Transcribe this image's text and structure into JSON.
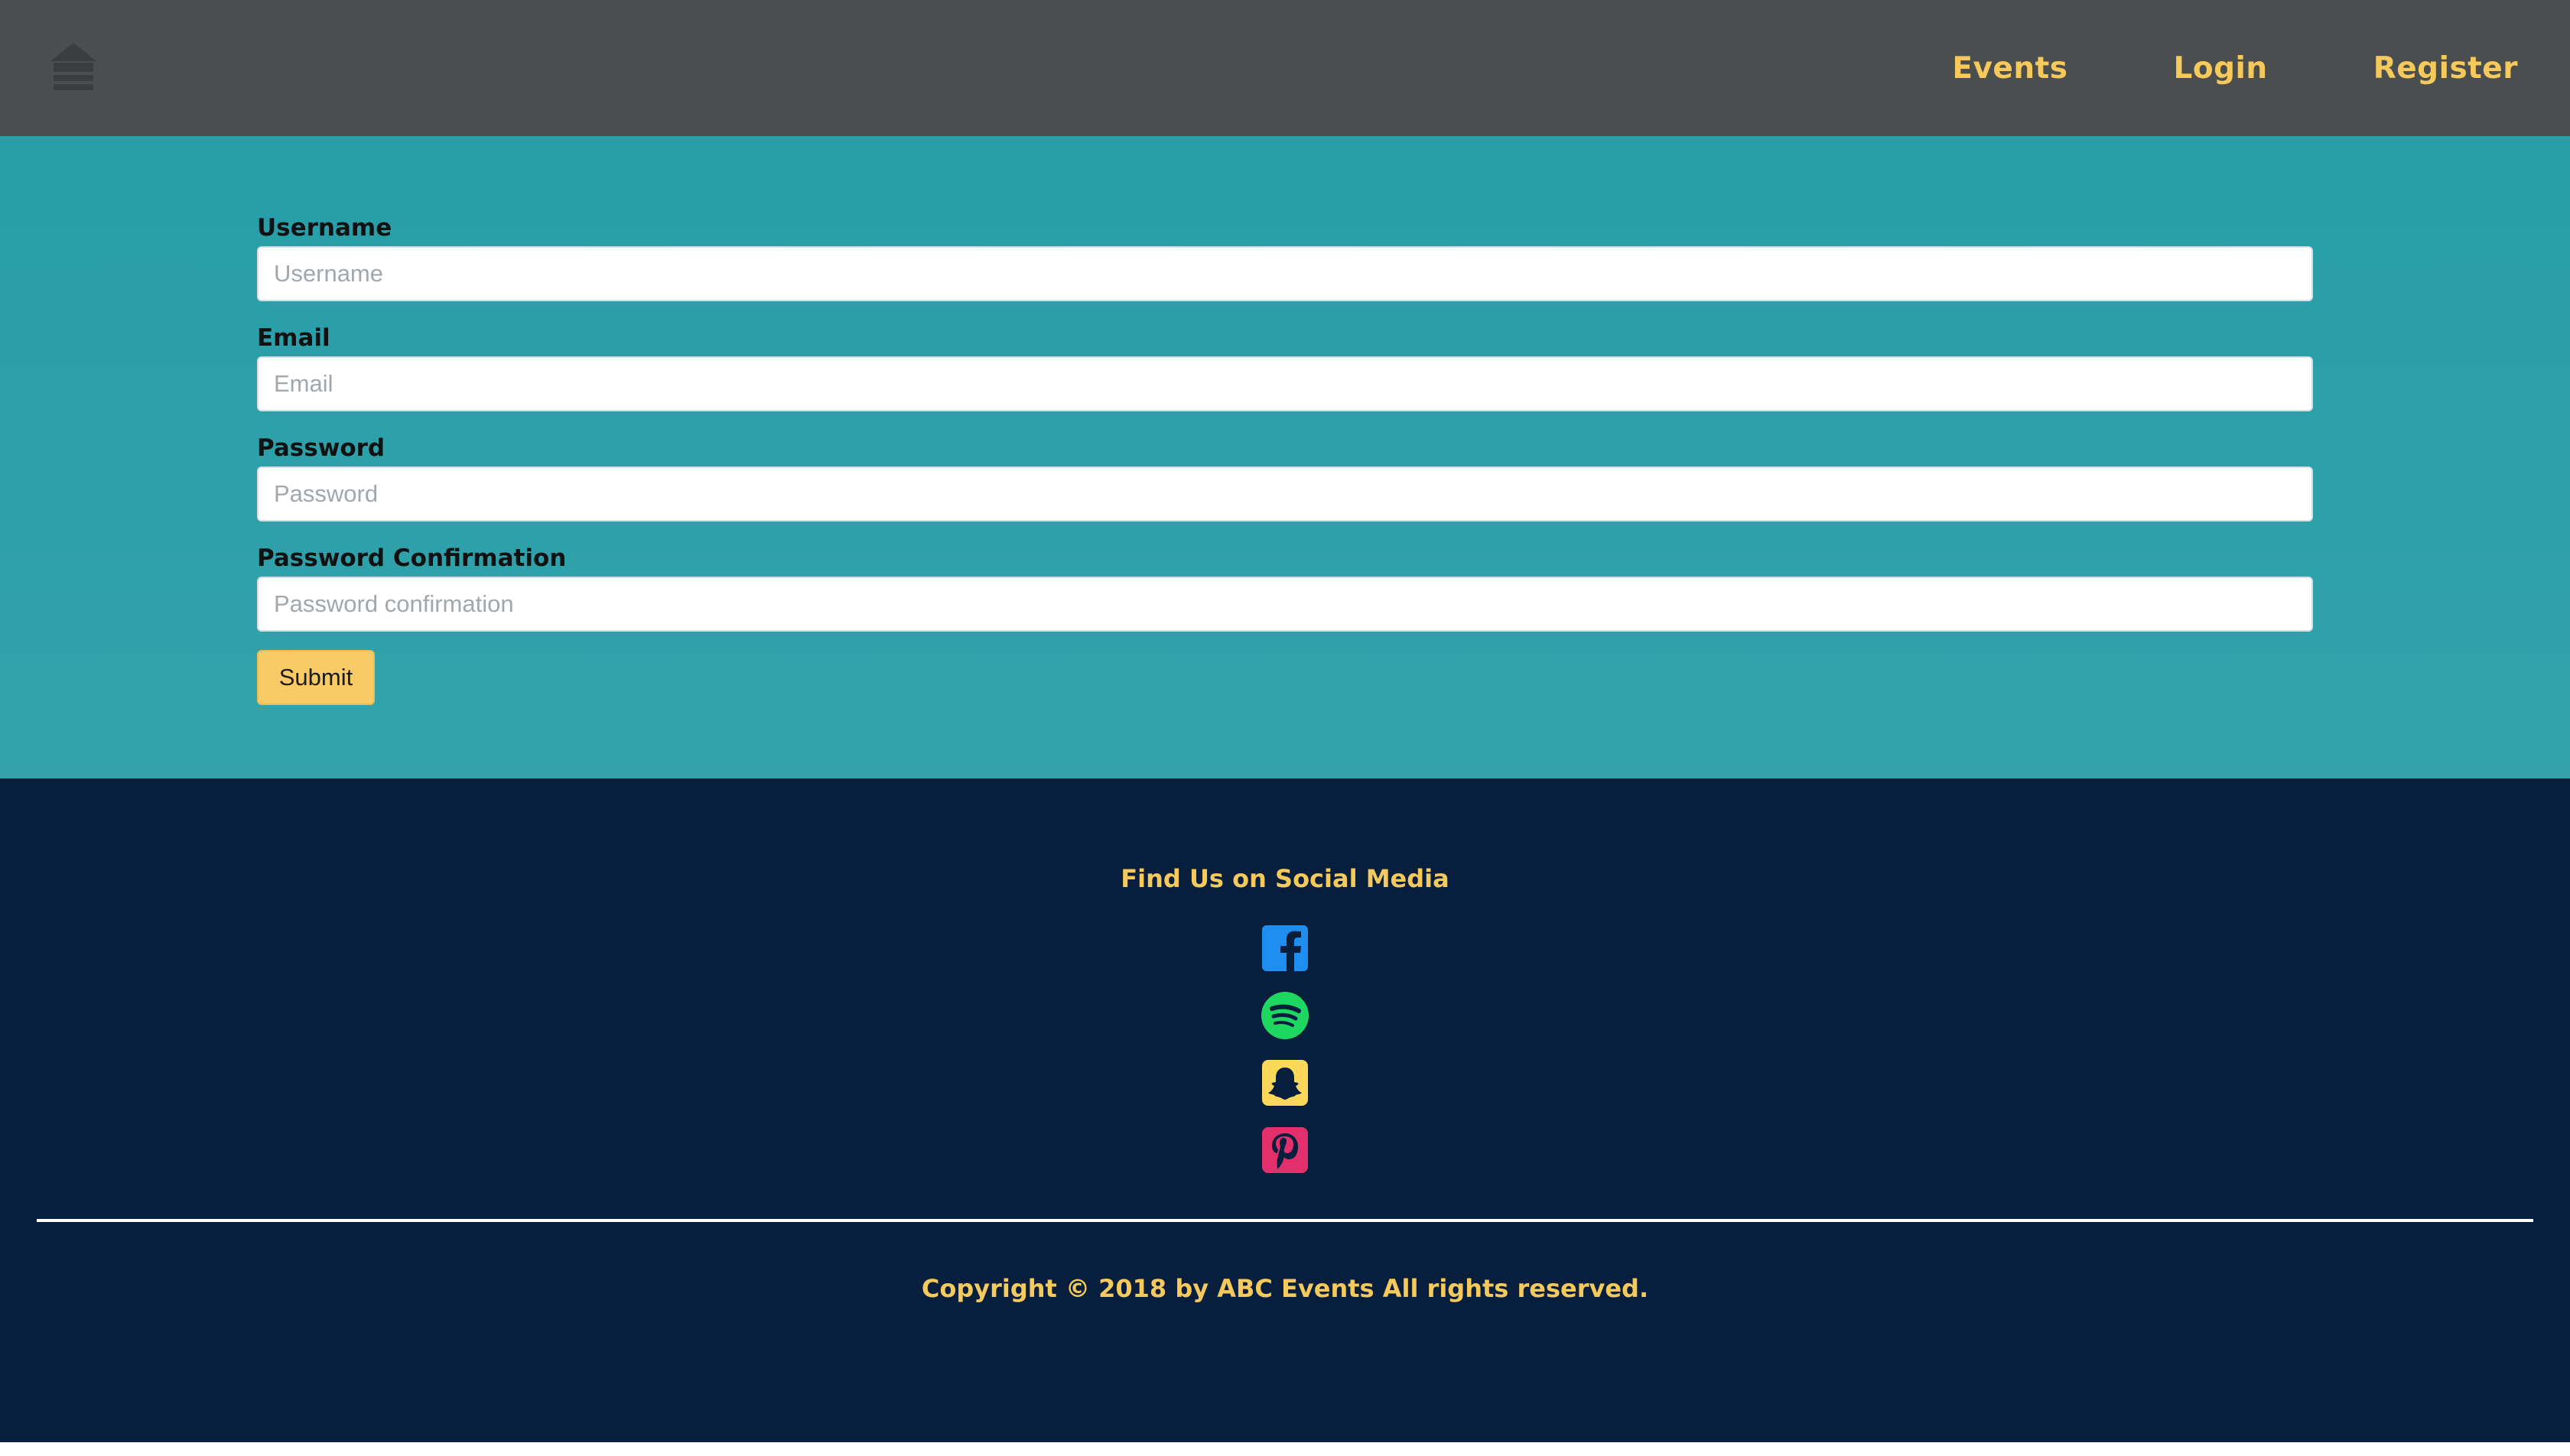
{
  "nav": {
    "home_icon": "home-icon",
    "links": [
      "Events",
      "Login",
      "Register"
    ]
  },
  "form": {
    "fields": [
      {
        "label": "Username",
        "placeholder": "Username",
        "value": ""
      },
      {
        "label": "Email",
        "placeholder": "Email",
        "value": ""
      },
      {
        "label": "Password",
        "placeholder": "Password",
        "value": ""
      },
      {
        "label": "Password Confirmation",
        "placeholder": "Password confirmation",
        "value": ""
      }
    ],
    "submit_label": "Submit"
  },
  "footer": {
    "heading": "Find Us on Social Media",
    "social": [
      {
        "icon": "facebook-icon",
        "color": "#1f8ef1"
      },
      {
        "icon": "spotify-icon",
        "color": "#1ed760"
      },
      {
        "icon": "snapchat-icon",
        "color": "#fcd85a"
      },
      {
        "icon": "pinterest-icon",
        "color": "#e1306c"
      }
    ],
    "copyright": "Copyright © 2018 by ABC Events All rights reserved."
  },
  "colors": {
    "navbar": "#4a4e4e",
    "accent": "#f6c95c",
    "form_bg": "#279ea8",
    "footer_bg": "#071e3d"
  }
}
